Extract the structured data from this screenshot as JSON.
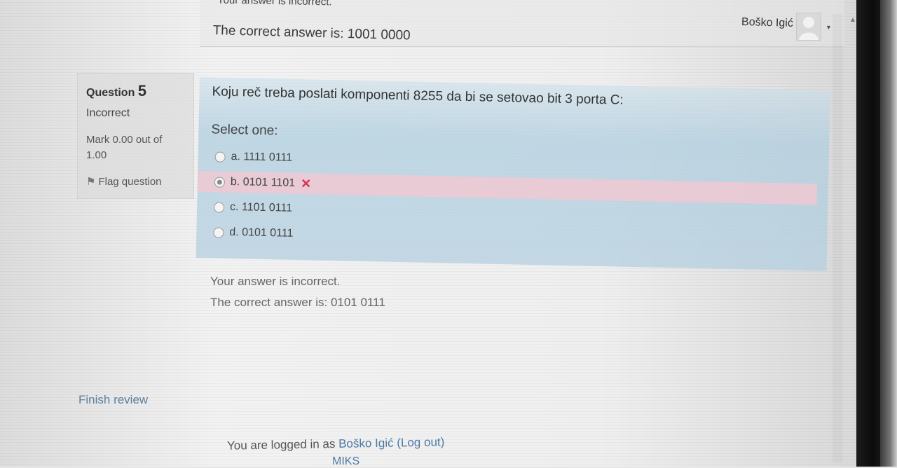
{
  "previous_question": {
    "feedback_general": "Your answer is incorrect.",
    "feedback_right": "The correct answer is: 1001 0000"
  },
  "user_menu": {
    "name": "Boško Igić"
  },
  "question": {
    "label": "Question",
    "number": "5",
    "state": "Incorrect",
    "grade": "Mark 0.00 out of 1.00",
    "flag_label": "Flag question",
    "text": "Koju reč treba poslati komponenti 8255 da bi se setovao bit 3 porta C:",
    "prompt": "Select one:",
    "answers": [
      {
        "label": "a. 1111 0111"
      },
      {
        "label": "b. 0101 1101"
      },
      {
        "label": "c. 1101 0111"
      },
      {
        "label": "d. 0101 0111"
      }
    ],
    "feedback_general": "Your answer is incorrect.",
    "feedback_right": "The correct answer is: 0101 0111"
  },
  "finish_review": "Finish review",
  "footer": {
    "prefix": "You are logged in as",
    "user": "Boško Igić",
    "logout": "(Log out)",
    "course": "MIKS"
  },
  "colors": {
    "formulation_bg": "#b8d2e2",
    "incorrect_bg": "#f2c8d2",
    "incorrect_icon": "#d9364e",
    "link": "#4d7aa5"
  }
}
